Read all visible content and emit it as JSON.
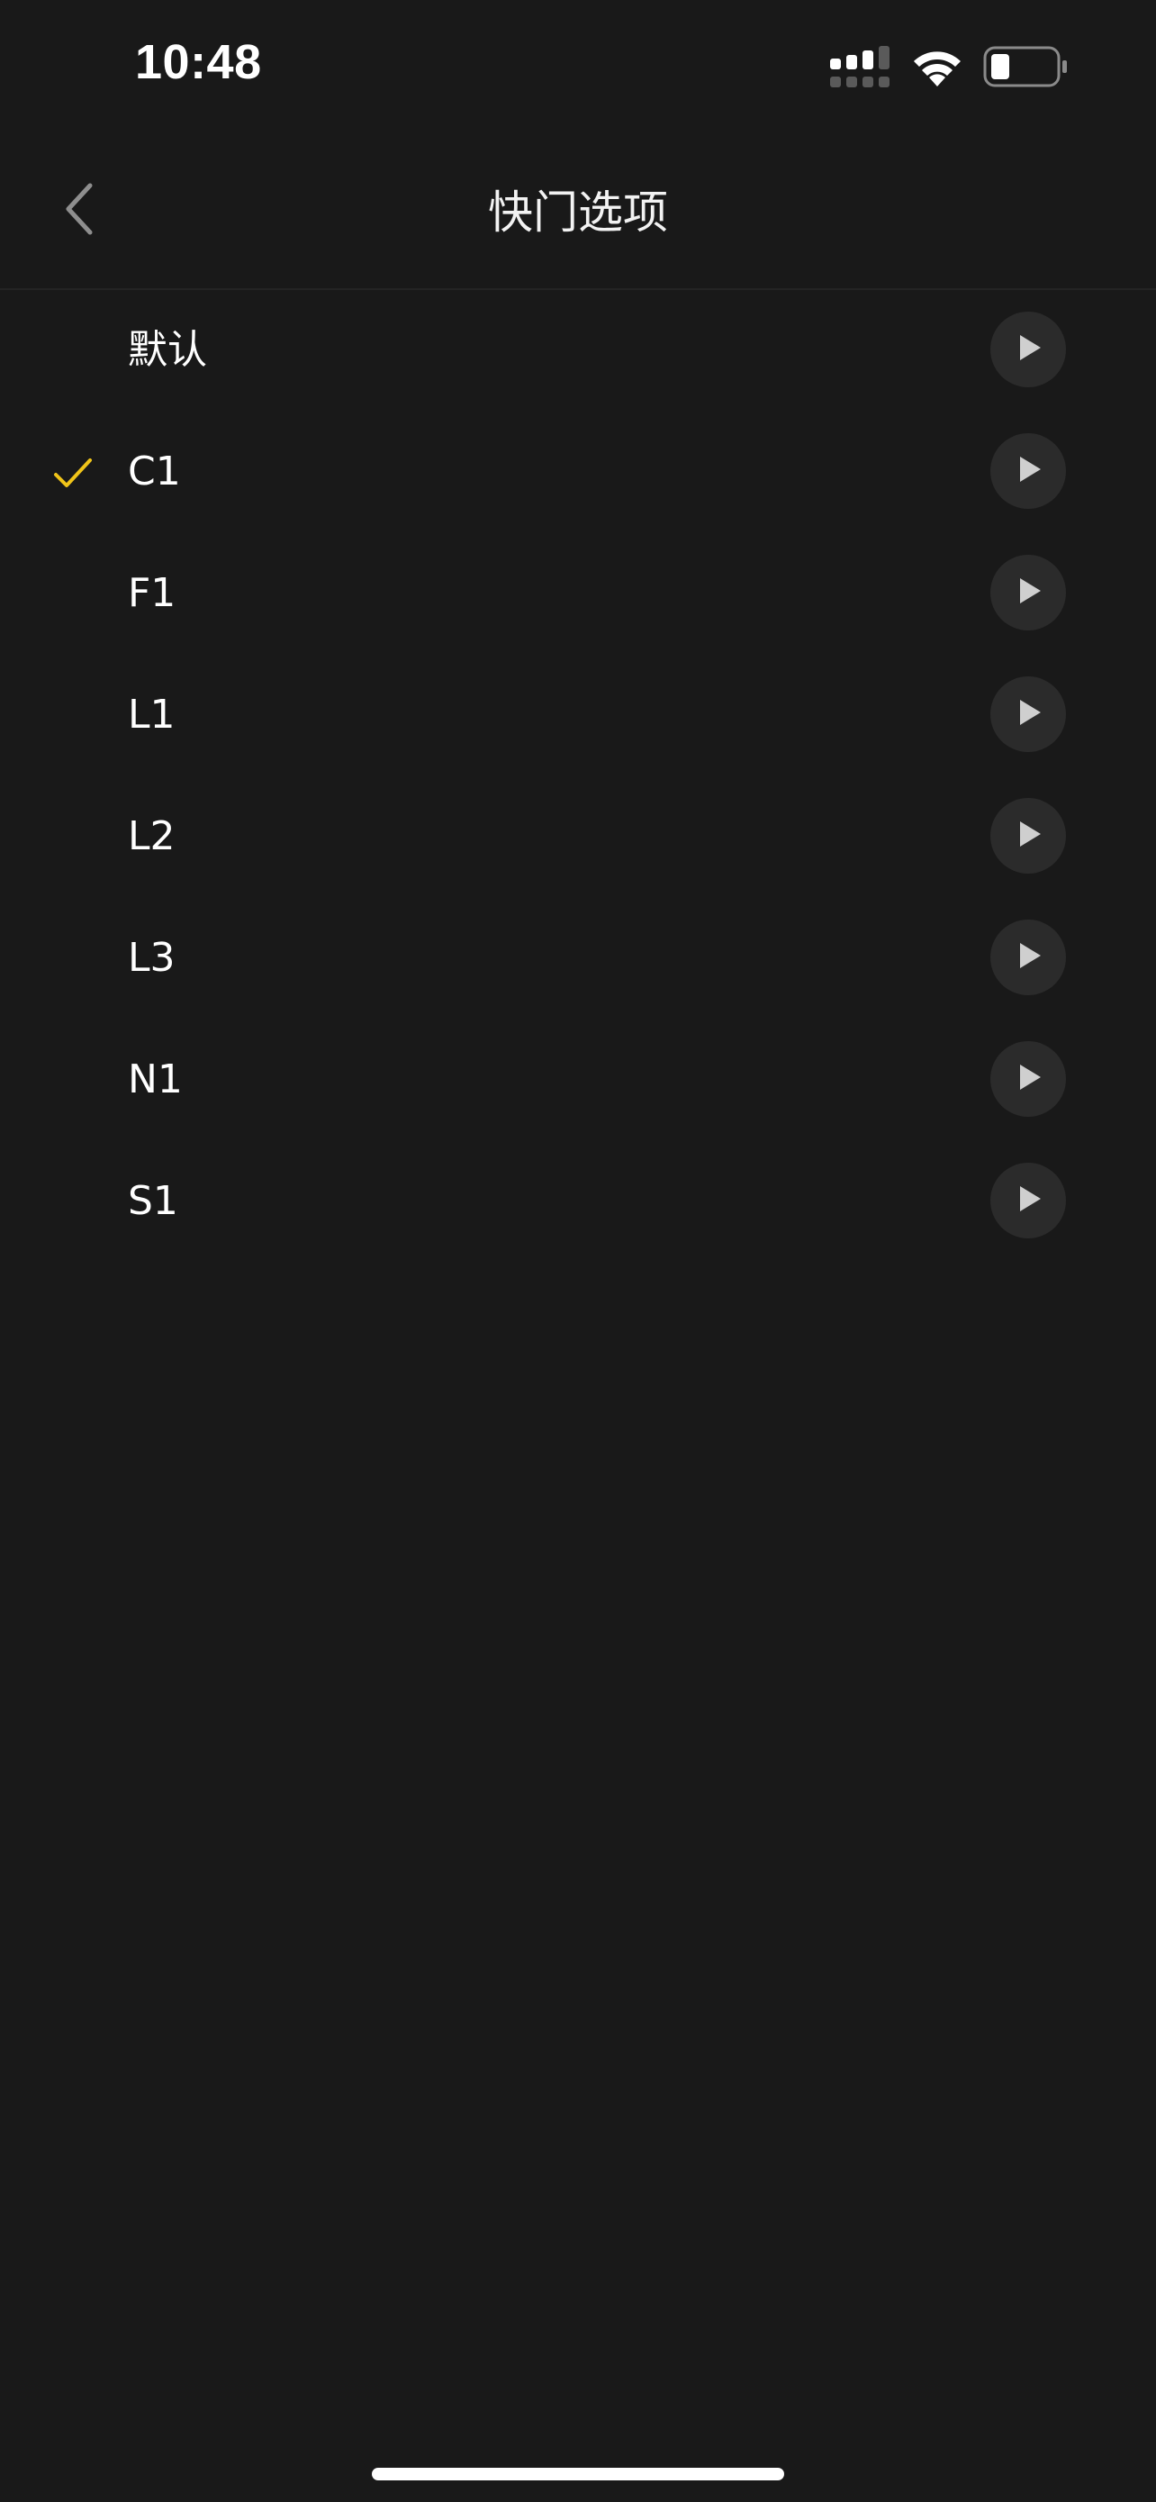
{
  "status_bar": {
    "time": "10:48",
    "icons": [
      "cellular-signal-icon",
      "wifi-icon",
      "battery-icon"
    ]
  },
  "nav": {
    "title": "快门选项",
    "back_icon": "chevron-left-icon"
  },
  "options": [
    {
      "label": "默认",
      "selected": false
    },
    {
      "label": "C1",
      "selected": true
    },
    {
      "label": "F1",
      "selected": false
    },
    {
      "label": "L1",
      "selected": false
    },
    {
      "label": "L2",
      "selected": false
    },
    {
      "label": "L3",
      "selected": false
    },
    {
      "label": "N1",
      "selected": false
    },
    {
      "label": "S1",
      "selected": false
    }
  ],
  "colors": {
    "background": "#191919",
    "accent": "#F0C419",
    "play_button_bg": "#2b2b2b",
    "play_triangle": "#cfcfcf"
  }
}
